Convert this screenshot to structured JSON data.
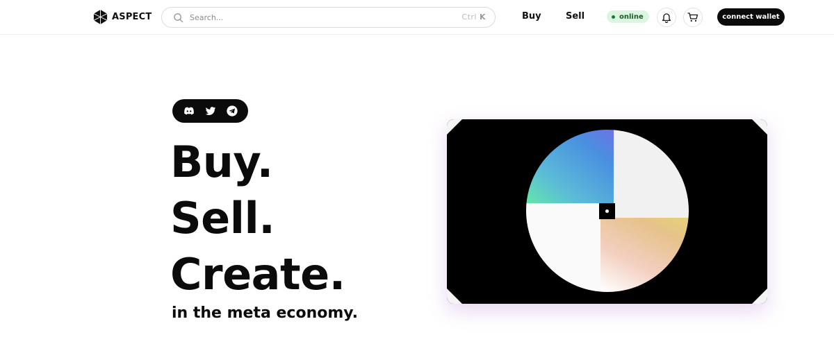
{
  "header": {
    "logo_text": "ASPECT",
    "search": {
      "placeholder": "Search...",
      "shortcut_ctrl": "Ctrl",
      "shortcut_key": "K"
    },
    "nav": {
      "buy_label": "Buy",
      "sell_label": "Sell"
    },
    "status": {
      "label": "online",
      "color": "#1a7a3a"
    },
    "icons": [
      "bell-icon",
      "cart-icon"
    ],
    "wallet_label": "connect wallet"
  },
  "hero": {
    "socials": [
      "discord-icon",
      "twitter-icon",
      "telegram-icon"
    ],
    "line_1": "Buy.",
    "line_2": "Sell.",
    "line_3": "Create.",
    "subtitle": "in the meta economy."
  },
  "artwork": {
    "description_icon": "quadrant-circle-artwork"
  }
}
